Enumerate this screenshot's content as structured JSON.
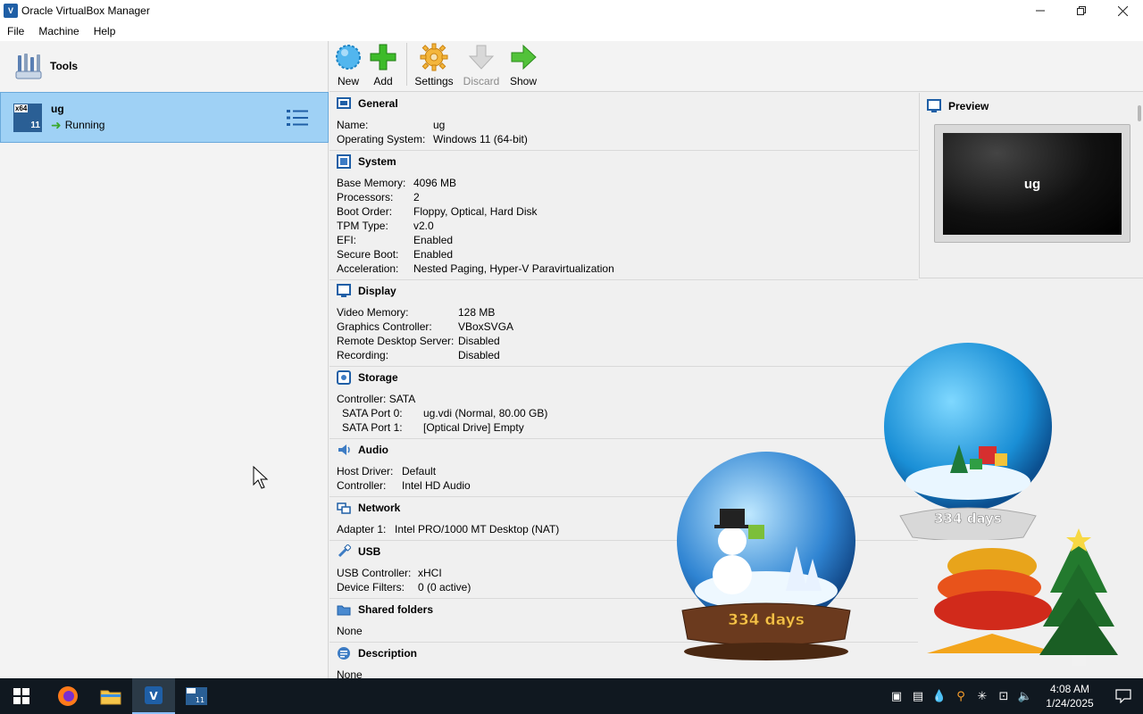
{
  "window": {
    "title": "Oracle VirtualBox Manager"
  },
  "menu": [
    "File",
    "Machine",
    "Help"
  ],
  "tools": {
    "label": "Tools"
  },
  "vm": {
    "name": "ug",
    "state": "Running",
    "os_badge": "x64",
    "os_version": "11"
  },
  "toolbar": [
    {
      "label": "New",
      "icon": "new-icon",
      "enabled": true
    },
    {
      "label": "Add",
      "icon": "add-icon",
      "enabled": true
    },
    {
      "label": "Settings",
      "icon": "settings-gear-icon",
      "enabled": true
    },
    {
      "label": "Discard",
      "icon": "discard-arrow-icon",
      "enabled": false
    },
    {
      "label": "Show",
      "icon": "show-arrow-icon",
      "enabled": true
    }
  ],
  "sections": [
    {
      "id": "general",
      "title": "General",
      "icon": "general-icon",
      "indent": 0,
      "rows": [
        [
          "Name:",
          "ug"
        ],
        [
          "Operating System:",
          "Windows 11 (64-bit)"
        ]
      ]
    },
    {
      "id": "system",
      "title": "System",
      "icon": "system-icon",
      "indent": 0,
      "rows": [
        [
          "Base Memory:",
          "4096 MB"
        ],
        [
          "Processors:",
          "2"
        ],
        [
          "Boot Order:",
          "Floppy, Optical, Hard Disk"
        ],
        [
          "TPM Type:",
          "v2.0"
        ],
        [
          "EFI:",
          "Enabled"
        ],
        [
          "Secure Boot:",
          "Enabled"
        ],
        [
          "Acceleration:",
          "Nested Paging, Hyper-V Paravirtualization"
        ]
      ]
    },
    {
      "id": "display",
      "title": "Display",
      "icon": "display-icon",
      "indent": 0,
      "rows": [
        [
          "Video Memory:",
          "128 MB"
        ],
        [
          "Graphics Controller:",
          "VBoxSVGA"
        ],
        [
          "Remote Desktop Server:",
          "Disabled"
        ],
        [
          "Recording:",
          "Disabled"
        ]
      ]
    },
    {
      "id": "storage",
      "title": "Storage",
      "icon": "storage-icon",
      "indent": 0,
      "rows": [
        [
          "Controller: SATA",
          ""
        ],
        [
          " SATA Port 0:",
          "ug.vdi (Normal, 80.00 GB)"
        ],
        [
          " SATA Port 1:",
          "[Optical Drive] Empty"
        ]
      ]
    },
    {
      "id": "audio",
      "title": "Audio",
      "icon": "audio-icon",
      "indent": 0,
      "rows": [
        [
          "Host Driver:",
          "Default"
        ],
        [
          "Controller:",
          "Intel HD Audio"
        ]
      ]
    },
    {
      "id": "network",
      "title": "Network",
      "icon": "network-icon",
      "indent": 0,
      "rows": [
        [
          "Adapter 1:",
          "Intel PRO/1000 MT Desktop (NAT)"
        ]
      ]
    },
    {
      "id": "usb",
      "title": "USB",
      "icon": "usb-icon",
      "indent": 0,
      "rows": [
        [
          "USB Controller:",
          "xHCI"
        ],
        [
          "Device Filters:",
          "0 (0 active)"
        ]
      ]
    },
    {
      "id": "shared",
      "title": "Shared folders",
      "icon": "shared-folders-icon",
      "indent": 0,
      "rows": [
        [
          "None",
          ""
        ]
      ]
    },
    {
      "id": "description",
      "title": "Description",
      "icon": "description-icon",
      "indent": 0,
      "rows": [
        [
          "None",
          ""
        ]
      ]
    }
  ],
  "preview": {
    "title": "Preview",
    "screen_text": "ug"
  },
  "decor": {
    "days_label": "334 days"
  },
  "taskbar": {
    "apps": [
      "firefox-icon",
      "file-explorer-icon",
      "virtualbox-icon",
      "vm-window-icon"
    ],
    "time": "4:08 AM",
    "date": "1/24/2025"
  }
}
